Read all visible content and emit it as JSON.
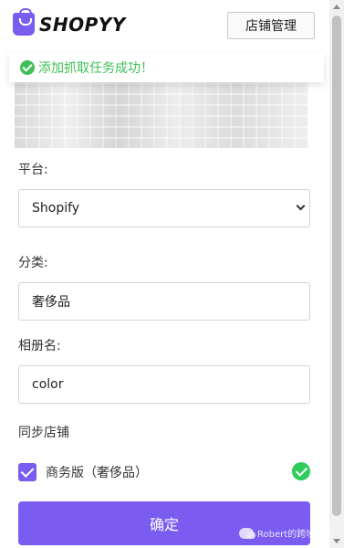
{
  "header": {
    "brand": "SHOPYY",
    "store_button": "店铺管理"
  },
  "toast": {
    "message": "添加抓取任务成功！",
    "color": "#3dbf56"
  },
  "form": {
    "platform_label": "平台:",
    "platform_value": "Shopify",
    "category_label": "分类:",
    "category_value": "奢侈品",
    "album_label": "相册名:",
    "album_value": "color",
    "sync_label": "同步店铺",
    "sync_store": "商务版（奢侈品）",
    "sync_checked": true,
    "confirm_button": "确定"
  },
  "watermark": {
    "text": "Robert的跨境日志"
  },
  "colors": {
    "accent": "#7a5cf0",
    "success": "#2ecc5a"
  }
}
